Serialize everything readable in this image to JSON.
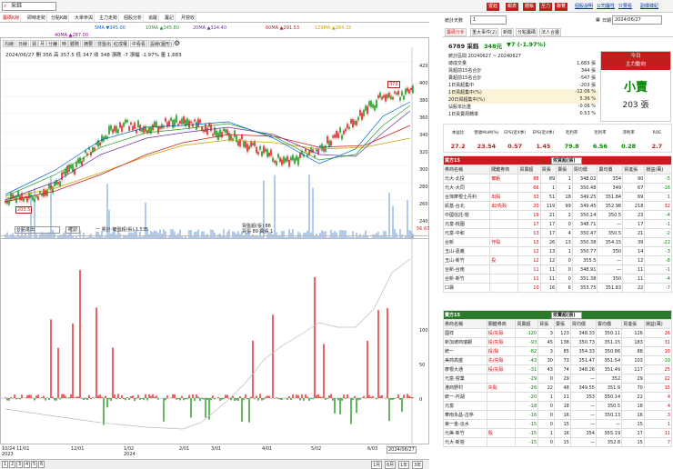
{
  "top": {
    "stock": "采鈺",
    "buttons": [
      "暨鈺",
      "報表",
      "體帳",
      "至力",
      "聯覽"
    ],
    "links": [
      "個股說明",
      "公司屬性",
      "只要看",
      "副價樣紀"
    ]
  },
  "menu": [
    "籌碼K線",
    "即時走勢",
    "分點K線",
    "大單參與",
    "主力走勢",
    "個股分析",
    "追蹤",
    "籌記",
    "月營收"
  ],
  "ma": [
    "5MA ▼345.00",
    "10MA ▲345.80",
    "20MA ▲324.40",
    "60MA ▲291.53",
    "120MA ▲284.33"
  ],
  "ma2": "40MA ▲287.00",
  "chart_tabs": [
    "均線",
    "日線",
    "週",
    "月",
    "分鐘",
    "時",
    "體務",
    "摘要",
    "非盤出",
    "紅成權",
    "中看看",
    "設線(圖形)"
  ],
  "quote_line": "2024/06/27 開 356 高 357.5 低 347 收 348 漲跌 -7 漲幅 -1.97% 量 1,683",
  "yticks": [
    "420",
    "400",
    "380",
    "360",
    "340",
    "320",
    "300",
    "280",
    "260",
    "240",
    "220",
    "200"
  ],
  "low_label": "203.5",
  "high_label": "373",
  "indicator": {
    "select": "分點進出",
    "btn": "確認",
    "line1": "一 累計-實盤超(張) 1,535",
    "line2": "買盤超(張) 88",
    "line3": "買張 89 賣張 1",
    "val": "56.67"
  },
  "yticks2": [
    "200",
    "150",
    "100",
    "50",
    "0",
    "-50"
  ],
  "xticks": [
    "10/24",
    "11/01",
    "12/01",
    "1/02",
    "2/01",
    "3/01",
    "4/01",
    "5/02",
    "6/03",
    "2024/06/27"
  ],
  "years": [
    "2023",
    "2024"
  ],
  "pages": [
    "1",
    "2",
    "3",
    "4",
    "5",
    "6"
  ],
  "periods": [
    "1月",
    "6月",
    "1年",
    "3年"
  ],
  "right": {
    "days_label": "統計天數",
    "days": "1",
    "date_label": "日期",
    "date": "2024/06/27",
    "tabs": [
      "籌碼分析",
      "重大事件(2)",
      "新聞",
      "分點籌碼",
      "法人合擾"
    ],
    "code": "6789 采鈺",
    "price": "348元",
    "chg": "▼7 (-1.97%)",
    "period": "統計區間 20240627 ~ 20240627",
    "today": "今日",
    "force": "主力動向",
    "action": "小賣",
    "amount": "203 張",
    "stats": [
      [
        "總成交量",
        "1,683 張"
      ],
      [
        "買超前15名合計",
        "344 張"
      ],
      [
        "賣超前15名合計",
        "-547 張"
      ],
      [
        "1日買超集中",
        "-203 張"
      ],
      [
        "1日買超集中(%)",
        "-12.06 %"
      ],
      [
        "20日買超集中(%)",
        "5.36 %"
      ],
      [
        "佔股本比重",
        "-0.06 %"
      ],
      [
        "1日買賣周轉率",
        "0.53 %"
      ]
    ],
    "fund_head": [
      "本益比",
      "營收MoM(%)",
      "EPS(近4季)",
      "EPS(近4季)",
      "毛利率",
      "毛利率",
      "淨利率",
      "ROE"
    ],
    "fund_val": [
      "27.2",
      "23.54",
      "0.57",
      "1.45",
      "79.8",
      "6.56",
      "0.28",
      "2.7"
    ],
    "buy_title": "買方15",
    "buy_mode": "依買超(張)",
    "cols": [
      "券商名稱",
      "關鍵券商",
      "買賣超",
      "買張",
      "賣張",
      "買均價",
      "賣均價",
      "買進張",
      "損益(萬)"
    ],
    "buy": [
      [
        "元大-北投",
        "實虧",
        "88",
        "89",
        "1",
        "348.02",
        "354",
        "90",
        "-5"
      ],
      [
        "元大-大同",
        "",
        "66",
        "1",
        "1",
        "350.48",
        "349",
        "67",
        "-16"
      ],
      [
        "台灣摩根士丹利",
        "出殼",
        "33",
        "51",
        "18",
        "349.25",
        "351.84",
        "69",
        "1"
      ],
      [
        "凱基-台北",
        "出/先殼",
        "20",
        "119",
        "99",
        "349.45",
        "352.98",
        "218",
        "32"
      ],
      [
        "中國信託-營",
        "",
        "19",
        "21",
        "2",
        "350.14",
        "350.5",
        "23",
        "-4"
      ],
      [
        "元富-桃園",
        "",
        "17",
        "17",
        "0",
        "348.71",
        "—",
        "17",
        "-1"
      ],
      [
        "元富-中和",
        "",
        "13",
        "17",
        "4",
        "350.47",
        "350.5",
        "21",
        "-2"
      ],
      [
        "台新",
        "作殼",
        "13",
        "26",
        "13",
        "350.38",
        "354.15",
        "39",
        "-22"
      ],
      [
        "玉山-嘉義",
        "",
        "12",
        "13",
        "1",
        "350.77",
        "350",
        "14",
        "-3"
      ],
      [
        "玉山-新竹",
        "投",
        "12",
        "12",
        "0",
        "355.5",
        "—",
        "12",
        "-8"
      ],
      [
        "台新-台南",
        "",
        "11",
        "11",
        "0",
        "348.91",
        "—",
        "11",
        "-1"
      ],
      [
        "台新-新竹",
        "",
        "11",
        "11",
        "0",
        "351.38",
        "350",
        "11",
        "-4"
      ],
      [
        "口袋",
        "",
        "10",
        "16",
        "6",
        "353.75",
        "351.83",
        "22",
        "-7"
      ]
    ],
    "sell_title": "賣方15",
    "sell_mode": "依賣超(張)",
    "sell": [
      [
        "國祥",
        "投/先殼",
        "-120",
        "3",
        "123",
        "348.33",
        "350.11",
        "126",
        "26"
      ],
      [
        "新加坡商瑞銀",
        "投/先殼",
        "-93",
        "45",
        "138",
        "350.73",
        "351.15",
        "183",
        "31"
      ],
      [
        "統一",
        "投/殼",
        "-82",
        "3",
        "85",
        "354.33",
        "350.86",
        "88",
        "10"
      ],
      [
        "美商高盛",
        "先/先殼",
        "-43",
        "30",
        "73",
        "351.47",
        "351.54",
        "103",
        "-10"
      ],
      [
        "摩根大通",
        "投/先殼",
        "-31",
        "43",
        "74",
        "348.26",
        "351.49",
        "117",
        "25"
      ],
      [
        "元富-營業",
        "",
        "-29",
        "0",
        "29",
        "—",
        "352",
        "29",
        "22"
      ],
      [
        "港商野村",
        "先殼",
        "-26",
        "22",
        "48",
        "349.55",
        "351.9",
        "70",
        "15"
      ],
      [
        "統一-內湖",
        "",
        "-20",
        "1",
        "21",
        "353",
        "350.14",
        "22",
        "4"
      ],
      [
        "元富",
        "",
        "-18",
        "0",
        "18",
        "—",
        "350.5",
        "18",
        "4"
      ],
      [
        "華南永昌-古亭",
        "",
        "-16",
        "0",
        "16",
        "—",
        "350.13",
        "16",
        "3"
      ],
      [
        "第一金-淡水",
        "",
        "-15",
        "0",
        "15",
        "—",
        "—",
        "15",
        "1"
      ],
      [
        "元美-新竹",
        "殼",
        "-15",
        "1",
        "16",
        "354",
        "355.19",
        "17",
        "11"
      ],
      [
        "元大-新營",
        "",
        "-15",
        "0",
        "15",
        "—",
        "352.8",
        "15",
        "7"
      ]
    ]
  },
  "colors": {
    "red": "#d00",
    "green": "#080",
    "yellow": "#c8a000"
  }
}
